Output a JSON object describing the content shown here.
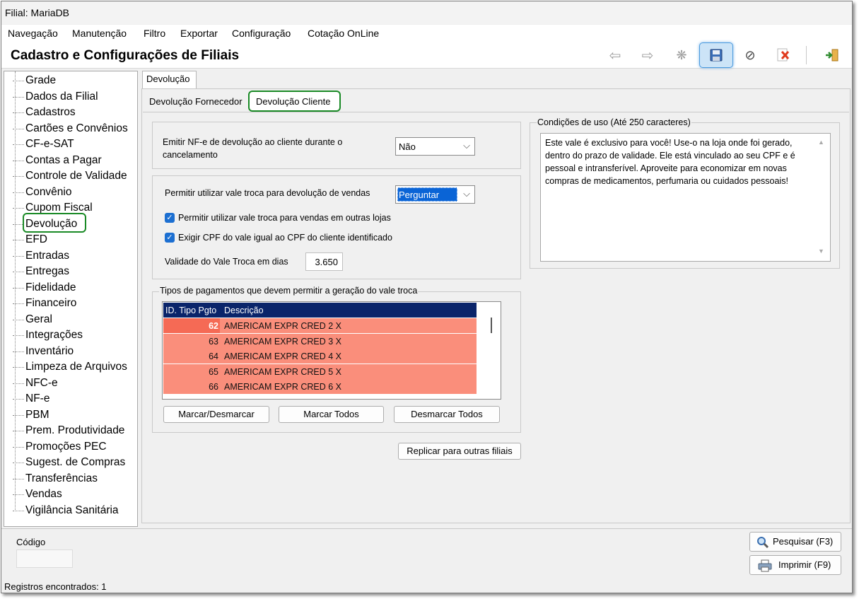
{
  "window": {
    "title": "Filial: MariaDB"
  },
  "menu": [
    "Navegação",
    "Manutenção",
    "Filtro",
    "Exportar",
    "Configuração",
    "Cotação OnLine"
  ],
  "header": {
    "title": "Cadastro e Configurações de Filiais"
  },
  "toolbar": {
    "icons": [
      "arrow-left-icon",
      "arrow-right-icon",
      "new-icon",
      "save-icon",
      "cancel-icon",
      "delete-icon",
      "exit-icon"
    ]
  },
  "sidebar": {
    "items": [
      "Grade",
      "Dados da Filial",
      "Cadastros",
      "Cartões e Convênios",
      "CF-e-SAT",
      "Contas a Pagar",
      "Controle de Validade",
      "Convênio",
      "Cupom Fiscal",
      "Devolução",
      "EFD",
      "Entradas",
      "Entregas",
      "Fidelidade",
      "Financeiro",
      "Geral",
      "Integrações",
      "Inventário",
      "Limpeza de Arquivos",
      "NFC-e",
      "NF-e",
      "PBM",
      "Prem. Produtividade",
      "Promoções PEC",
      "Sugest. de Compras",
      "Transferências",
      "Vendas",
      "Vigilância Sanitária"
    ],
    "selected": "Devolução"
  },
  "tabs": {
    "outer": "Devolução",
    "inner": [
      "Devolução Fornecedor",
      "Devolução Cliente"
    ],
    "active": "Devolução Cliente"
  },
  "form": {
    "emitir_label": "Emitir NF-e de devolução ao cliente  durante o cancelamento",
    "emitir_value": "Não",
    "permitir_label": "Permitir utilizar vale troca para devolução de vendas",
    "permitir_value": "Perguntar",
    "chk_outras_lojas": "Permitir utilizar vale troca para vendas em outras lojas",
    "chk_cpf": "Exigir CPF do vale igual ao CPF do cliente identificado",
    "validade_label": "Validade do Vale Troca em dias",
    "validade_value": "3.650"
  },
  "tipos": {
    "title": "Tipos de pagamentos que devem permitir a geração do vale troca",
    "columns": [
      "ID. Tipo Pgto",
      "Descrição"
    ],
    "rows": [
      {
        "id": "62",
        "desc": "AMERICAM EXPR CRED 2 X"
      },
      {
        "id": "63",
        "desc": "AMERICAM EXPR CRED 3 X"
      },
      {
        "id": "64",
        "desc": "AMERICAM EXPR CRED 4 X"
      },
      {
        "id": "65",
        "desc": "AMERICAM EXPR CRED 5 X"
      },
      {
        "id": "66",
        "desc": "AMERICAM EXPR CRED 6 X"
      }
    ],
    "btn_marcar_desmarcar": "Marcar/Desmarcar",
    "btn_marcar_todos": "Marcar Todos",
    "btn_desmarcar_todos": "Desmarcar Todos"
  },
  "replicar": "Replicar para outras filiais",
  "condicoes": {
    "title": "Condições de uso (Até 250 caracteres)",
    "text": "Este vale é exclusivo para você! Use-o na loja onde foi gerado, dentro do prazo de validade. Ele está vinculado ao seu CPF e é pessoal e intransferível. Aproveite para economizar em novas compras de medicamentos, perfumaria ou cuidados pessoais!"
  },
  "bottom": {
    "codigo_label": "Código",
    "codigo_value": "",
    "pesquisar": "Pesquisar (F3)",
    "imprimir": "Imprimir (F9)"
  },
  "status": "Registros encontrados: 1",
  "colors": {
    "grid_header": "#0a246a",
    "grid_row": "#fa8e7b",
    "highlight": "#1a8a26",
    "checkbox": "#1c6fd1"
  }
}
